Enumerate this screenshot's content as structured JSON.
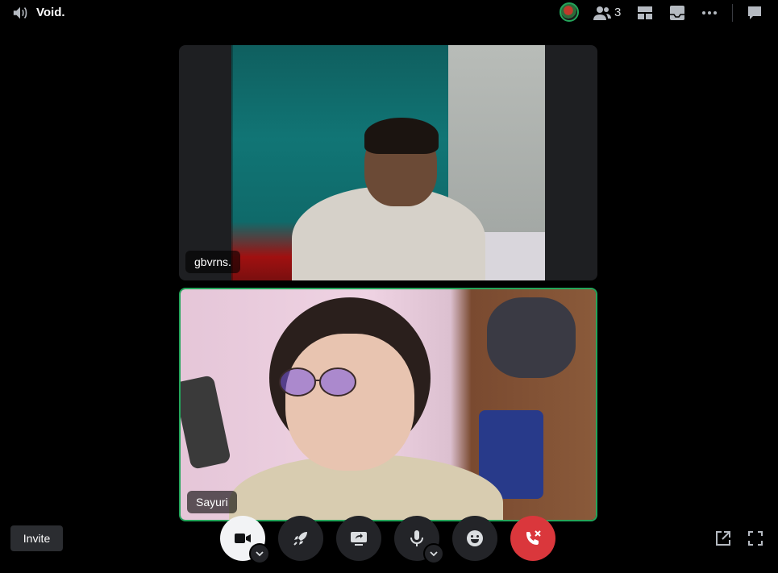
{
  "header": {
    "channel_name": "Void.",
    "participant_count": "3",
    "icons": [
      "speaker-icon",
      "avatar",
      "people-icon",
      "grid-layout-icon",
      "inbox-icon",
      "more-icon",
      "chat-icon"
    ]
  },
  "participants": [
    {
      "name": "gbvrns.",
      "speaking": false
    },
    {
      "name": "Sayuri",
      "speaking": true
    }
  ],
  "footer": {
    "invite_label": "Invite",
    "controls": [
      "camera",
      "activities",
      "screen-share",
      "microphone",
      "soundboard",
      "disconnect"
    ],
    "camera_active": true
  },
  "colors": {
    "background": "#000000",
    "speaking_border": "#23a55a",
    "disconnect": "#da373c",
    "control_bg": "#232428"
  }
}
